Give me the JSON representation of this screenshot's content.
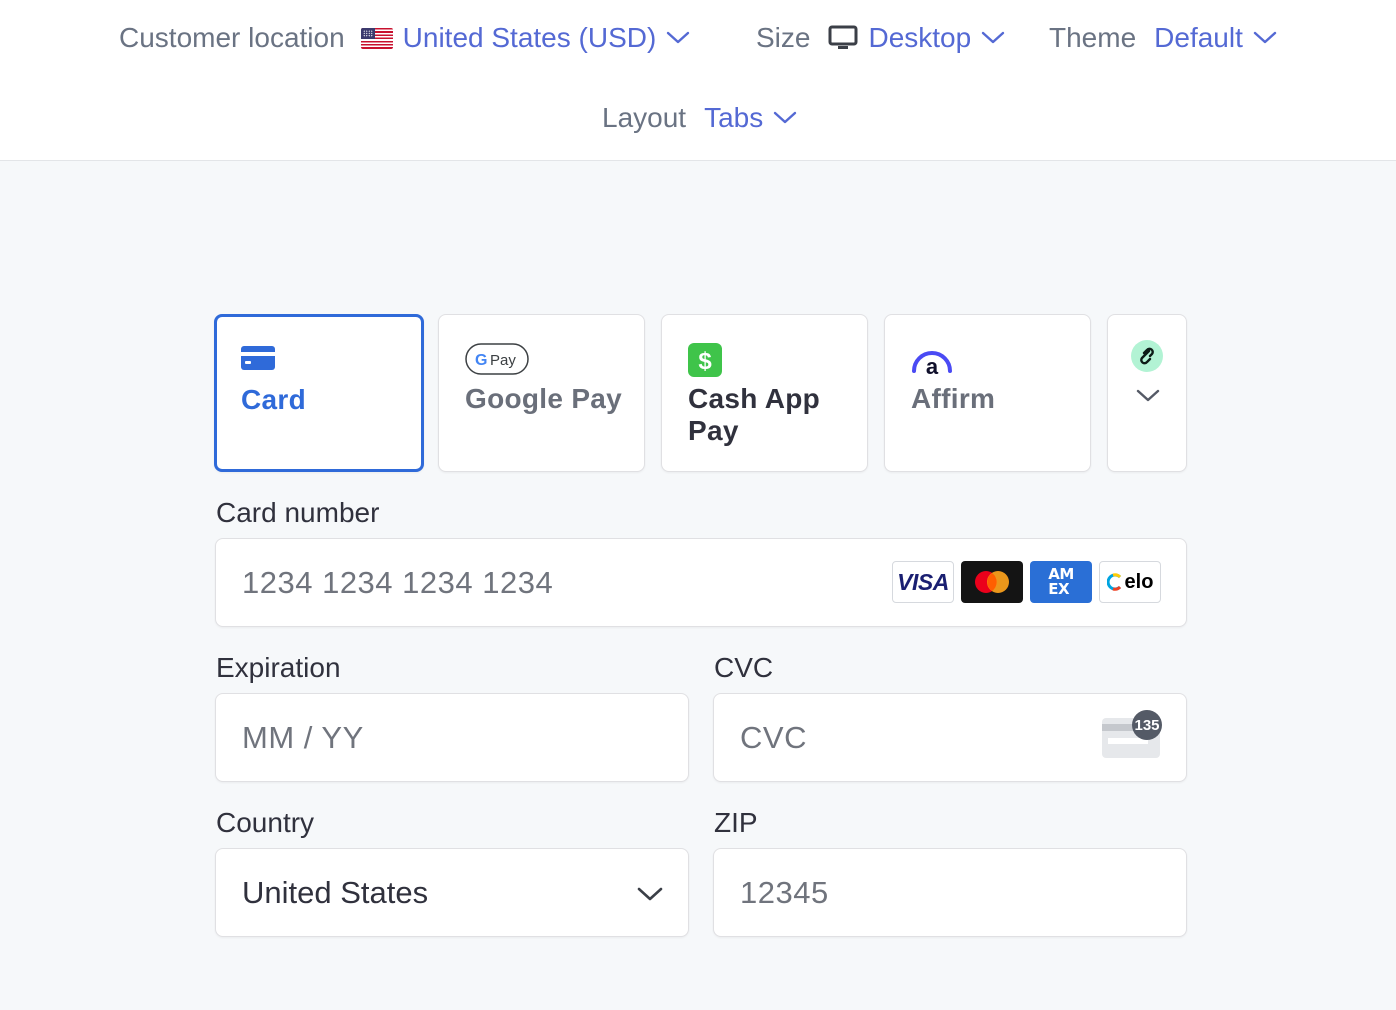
{
  "toolbar": {
    "customer_location": {
      "label": "Customer location",
      "value": "United States (USD)",
      "flag_icon": "us-flag-icon"
    },
    "size": {
      "label": "Size",
      "value": "Desktop",
      "icon": "desktop-icon"
    },
    "theme": {
      "label": "Theme",
      "value": "Default"
    },
    "layout": {
      "label": "Layout",
      "value": "Tabs"
    }
  },
  "payment_tabs": [
    {
      "label": "Card",
      "icon": "card-icon",
      "selected": true
    },
    {
      "label": "Google Pay",
      "icon": "google-pay-icon",
      "selected": false
    },
    {
      "label": "Cash App Pay",
      "icon": "cash-app-icon",
      "selected": false
    },
    {
      "label": "Affirm",
      "icon": "affirm-icon",
      "selected": false
    },
    {
      "label": "",
      "icon": "link-icon",
      "more_icon": "chevron-down-icon",
      "selected": false
    }
  ],
  "form": {
    "card_number": {
      "label": "Card number",
      "placeholder": "1234 1234 1234 1234",
      "brands": [
        "VISA",
        "Mastercard",
        "AMEX",
        "elo"
      ]
    },
    "expiration": {
      "label": "Expiration",
      "placeholder": "MM / YY"
    },
    "cvc": {
      "label": "CVC",
      "placeholder": "CVC",
      "hint_number": "135"
    },
    "country": {
      "label": "Country",
      "value": "United States"
    },
    "zip": {
      "label": "ZIP",
      "placeholder": "12345"
    }
  },
  "colors": {
    "accent": "#5469d4",
    "selected_tab": "#2f6ad9",
    "background": "#f6f8fa",
    "cash_app_green": "#3fc44a",
    "amex_blue": "#2a6fd6"
  }
}
